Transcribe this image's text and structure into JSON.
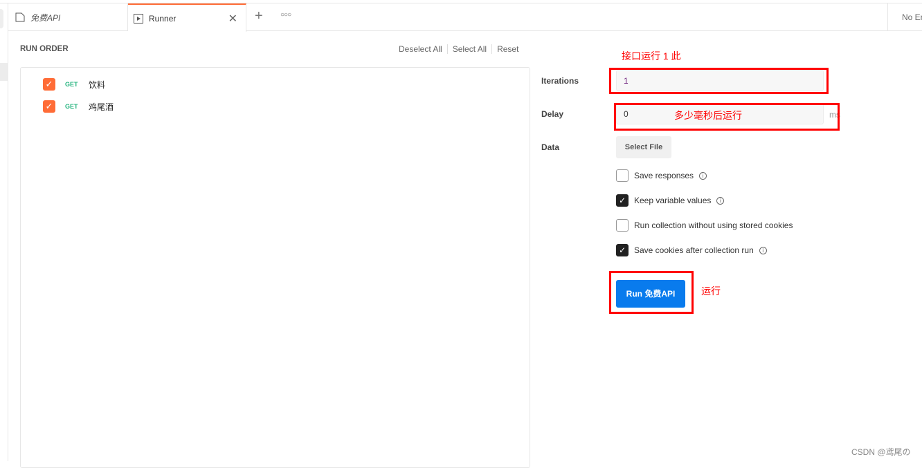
{
  "tabs": [
    {
      "label": "免费API",
      "icon": "collection-icon"
    },
    {
      "label": "Runner",
      "icon": "runner-icon"
    }
  ],
  "environment": "No Environment",
  "run_order": {
    "title": "RUN ORDER",
    "deselect_all": "Deselect All",
    "select_all": "Select All",
    "reset": "Reset",
    "items": [
      {
        "method": "GET",
        "name": "饮料",
        "checked": true
      },
      {
        "method": "GET",
        "name": "鸡尾酒",
        "checked": true
      }
    ]
  },
  "settings": {
    "iterations_label": "Iterations",
    "iterations_value": "1",
    "delay_label": "Delay",
    "delay_value": "0",
    "delay_unit": "ms",
    "data_label": "Data",
    "select_file": "Select File",
    "options": [
      {
        "label": "Save responses",
        "checked": false,
        "info": true
      },
      {
        "label": "Keep variable values",
        "checked": true,
        "info": true
      },
      {
        "label": "Run collection without using stored cookies",
        "checked": false,
        "info": false
      },
      {
        "label": "Save cookies after collection run",
        "checked": true,
        "info": true
      }
    ],
    "run_button": "Run 免费API"
  },
  "annotations": {
    "iterations": "接口运行 1 此",
    "delay": "多少毫秒后运行",
    "run": "运行"
  },
  "watermark": "CSDN @鸢尾の",
  "colors": {
    "accent": "#ff6c37",
    "run": "#097bed",
    "annotation": "#ff0000",
    "get": "#26b47f"
  }
}
